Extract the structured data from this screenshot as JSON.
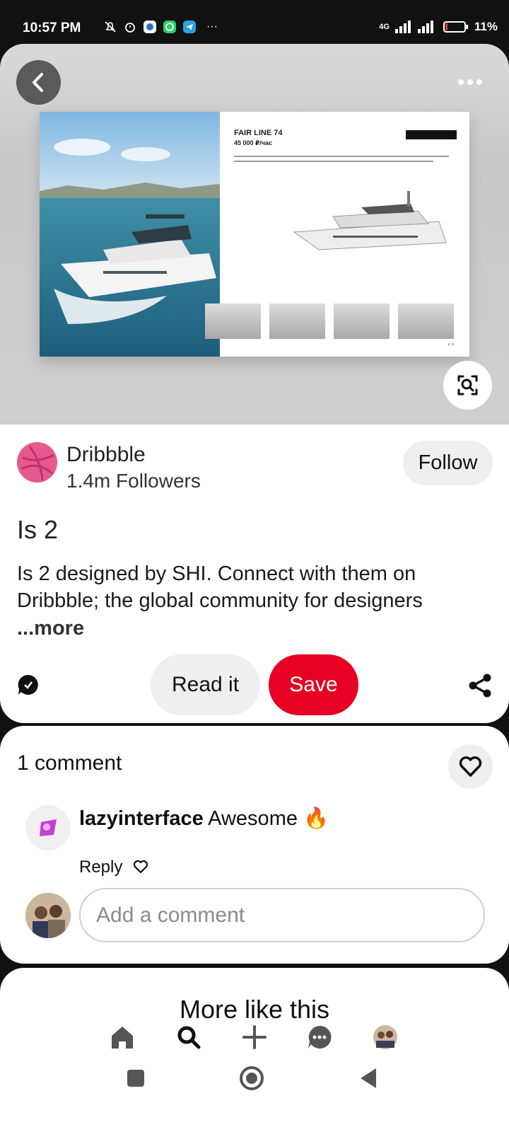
{
  "status_bar": {
    "time": "10:57 PM",
    "battery": "11%",
    "network": "4G"
  },
  "pin": {
    "mockup": {
      "title": "FAIR LINE 74",
      "price": "45 000 ₽/час"
    }
  },
  "profile": {
    "name": "Dribbble",
    "followers": "1.4m Followers",
    "follow_label": "Follow"
  },
  "post": {
    "title": "Is 2",
    "description": "Is 2 designed by SHI. Connect with them on Dribbble; the global community for designers",
    "more_label": "...more"
  },
  "actions": {
    "read_label": "Read it",
    "save_label": "Save"
  },
  "comments": {
    "count_label": "1 comment",
    "items": [
      {
        "user": "lazyinterface",
        "text": "Awesome 🔥",
        "reply_label": "Reply"
      }
    ],
    "input_placeholder": "Add a comment"
  },
  "more_like_this": {
    "title": "More like this"
  },
  "colors": {
    "save_red": "#e60023",
    "dribbble_pink": "#e8588f",
    "pill_gray": "#efefef"
  },
  "icons": [
    "back-arrow-icon",
    "more-dots-icon",
    "visual-search-icon",
    "comment-icon",
    "share-icon",
    "heart-icon",
    "home-icon",
    "search-icon",
    "plus-icon",
    "messages-icon",
    "profile-avatar-icon"
  ]
}
